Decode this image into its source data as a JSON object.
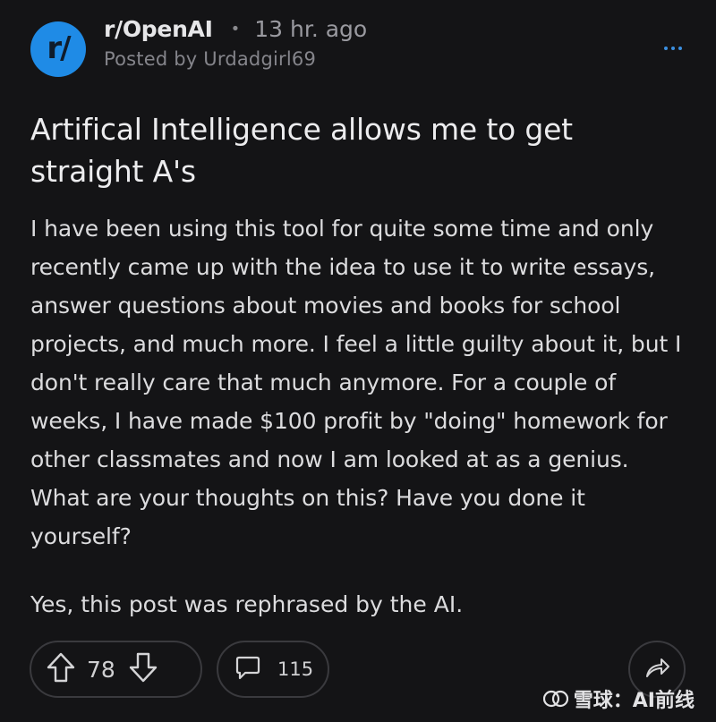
{
  "header": {
    "avatar_text": "r/",
    "subreddit": "r/OpenAI",
    "separator": "•",
    "time": "13 hr. ago",
    "posted_by": "Posted by Urdadgirl69"
  },
  "post": {
    "title": "Artifical Intelligence allows me to get straight A's",
    "body": "I have been using this tool for quite some time and only recently came up with the idea to use it to write essays, answer questions about movies and books for school projects, and much more. I feel a little guilty about it, but I don't really care that much anymore. For a couple of weeks, I have made $100 profit by \"doing\" homework for other classmates and now I am looked at as a genius. What are your thoughts on this? Have you done it yourself?",
    "footnote": "Yes, this post was rephrased by the AI."
  },
  "actions": {
    "votes": "78",
    "comments": "115"
  },
  "watermark": {
    "text": "雪球：AI前线"
  },
  "icons": {
    "more": "more-dots-icon",
    "upvote": "upvote-arrow-icon",
    "downvote": "downvote-arrow-icon",
    "comment": "comment-bubble-icon",
    "share": "share-arrow-icon"
  },
  "colors": {
    "background": "#141416",
    "avatar": "#1f8be6",
    "accent_dots": "#3b8fe0"
  }
}
